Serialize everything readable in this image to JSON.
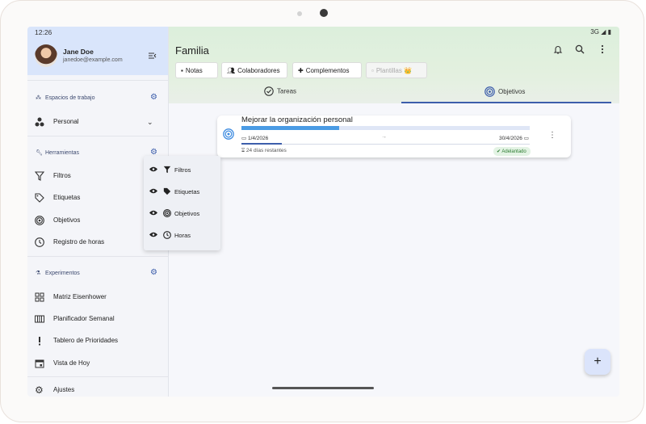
{
  "status_bar": {
    "time": "12:26",
    "network": "3G"
  },
  "user": {
    "name": "Jane Doe",
    "email": "janedoe@example.com"
  },
  "sidebar": {
    "workspaces_title": "Espacios de trabajo",
    "workspace_selected": "Personal",
    "tools_title": "Herramientas",
    "tools": [
      {
        "label": "Filtros",
        "icon": "filter-icon"
      },
      {
        "label": "Etiquetas",
        "icon": "tag-icon"
      },
      {
        "label": "Objetivos",
        "icon": "target-icon"
      },
      {
        "label": "Registro de horas",
        "icon": "clock-icon"
      }
    ],
    "experiments_title": "Experimentos",
    "experiments": [
      {
        "label": "Matriz Eisenhower",
        "icon": "grid-icon"
      },
      {
        "label": "Planificador Semanal",
        "icon": "columns-icon"
      },
      {
        "label": "Tablero de Prioridades",
        "icon": "exclamation-icon"
      },
      {
        "label": "Vista de Hoy",
        "icon": "calendar-icon"
      }
    ],
    "settings_label": "Ajustes"
  },
  "tools_popup": {
    "items": [
      {
        "label": "Filtros",
        "icon": "filter-icon"
      },
      {
        "label": "Etiquetas",
        "icon": "tag-icon"
      },
      {
        "label": "Objetivos",
        "icon": "target-icon"
      },
      {
        "label": "Horas",
        "icon": "clock-icon"
      }
    ]
  },
  "header": {
    "title": "Familia",
    "chips": [
      {
        "label": "Notas",
        "icon": "note-icon",
        "enabled": true
      },
      {
        "label": "Colaboradores",
        "icon": "people-icon",
        "enabled": true
      },
      {
        "label": "Complementos",
        "icon": "puzzle-icon",
        "enabled": true
      },
      {
        "label": "Plantillas 👑",
        "icon": "template-icon",
        "enabled": false
      }
    ],
    "tabs": [
      {
        "label": "Tareas",
        "icon": "check-circle-icon",
        "active": false
      },
      {
        "label": "Objetivos",
        "icon": "target-icon",
        "active": true
      }
    ]
  },
  "goal": {
    "title": "Mejorar la organización personal",
    "progress": 0.34,
    "start_date": "1/4/2026",
    "end_date": "30/4/2026",
    "time_elapsed": 0.14,
    "remaining": "24 días restantes",
    "status": "Adelantado"
  },
  "colors": {
    "accent": "#3d5eab",
    "progress": "#4a9be4",
    "status_green": "#2e7d32"
  }
}
